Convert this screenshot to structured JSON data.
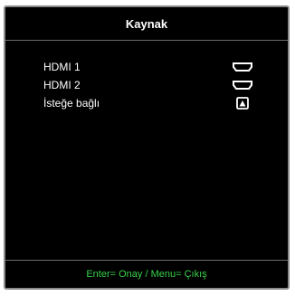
{
  "menu": {
    "title": "Kaynak",
    "items": [
      {
        "label": "HDMI 1",
        "icon": "hdmi-port-icon"
      },
      {
        "label": "HDMI 2",
        "icon": "hdmi-port-icon"
      },
      {
        "label": "İsteğe bağlı",
        "icon": "optional-source-icon"
      }
    ]
  },
  "footer": {
    "hint": "Enter= Onay / Menu= Çıkış"
  },
  "colors": {
    "background": "#000000",
    "text": "#ffffff",
    "footer_text": "#39d14a",
    "frame_border": "#8a8a8a"
  }
}
